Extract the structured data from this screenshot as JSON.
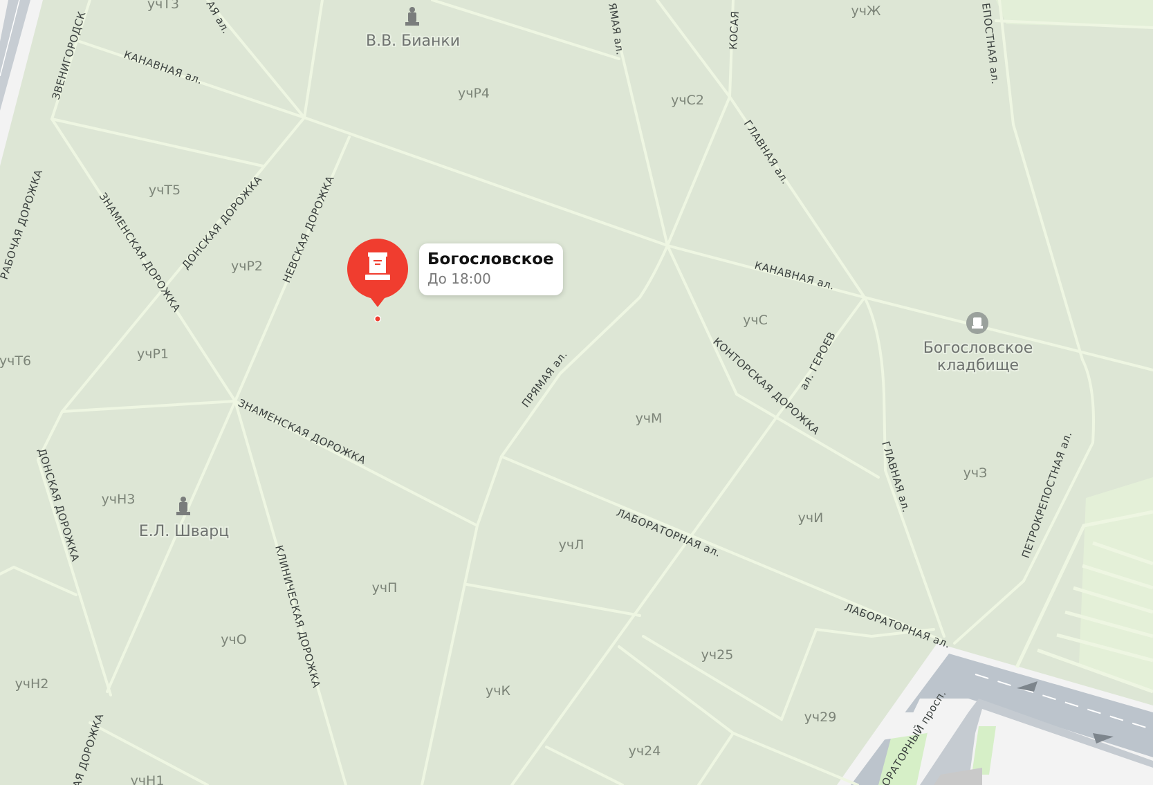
{
  "colors": {
    "background": "#dde6d5",
    "path": "#eef6e2",
    "pin": "#f03d2f",
    "road": "#b9c0c8",
    "sidewalk": "#f3f3f3"
  },
  "selected_place": {
    "name": "Богословское",
    "hours": "До 18:00",
    "icon": "cemetery-tombstone-icon"
  },
  "pois": [
    {
      "id": "bianki",
      "name": "В.В. Бианки",
      "icon": "monument-icon"
    },
    {
      "id": "shvarts",
      "name": "Е.Л. Шварц",
      "icon": "monument-icon"
    },
    {
      "id": "cemetery",
      "name_line1": "Богословское",
      "name_line2": "кладбище",
      "icon": "cemetery-icon"
    }
  ],
  "streets": [
    "ЗВЕНИГОРОДСК",
    "КАНАВНАЯ ал.",
    "ЗНАМЕНСКАЯ ДОРОЖКА",
    "ДОНСКАЯ ДОРОЖКА",
    "НЕВСКАЯ ДОРОЖКА",
    "ПРЯМАЯ ал.",
    "КОСАЯ",
    "ГЛАВНАЯ ал.",
    "КОНТОРСКАЯ ДОРОЖКА",
    "ал. ГЕРОЕВ",
    "ЛАБОРАТОРНАЯ ал.",
    "ПЕТРОКРЕПОСТНАЯ ал.",
    "ЕПОСТНАЯ ал.",
    "КЛИНИЧЕСКАЯ ДОРОЖКА",
    "РАБОЧАЯ ДОРОЖКА",
    "ОРАТОРНЫЙ просп.",
    "АЯ ДОРОЖКА",
    "АЯ ал.",
    "ЯМАЯ ал."
  ],
  "plots": [
    "учТ3",
    "учР4",
    "учС2",
    "учЖ",
    "учТ5",
    "учР2",
    "учР1",
    "учТ6",
    "учС",
    "учМ",
    "учЗ",
    "учН3",
    "учИ",
    "учЛ",
    "учП",
    "учО",
    "учН2",
    "учК",
    "уч25",
    "уч29",
    "уч24",
    "учН1"
  ]
}
